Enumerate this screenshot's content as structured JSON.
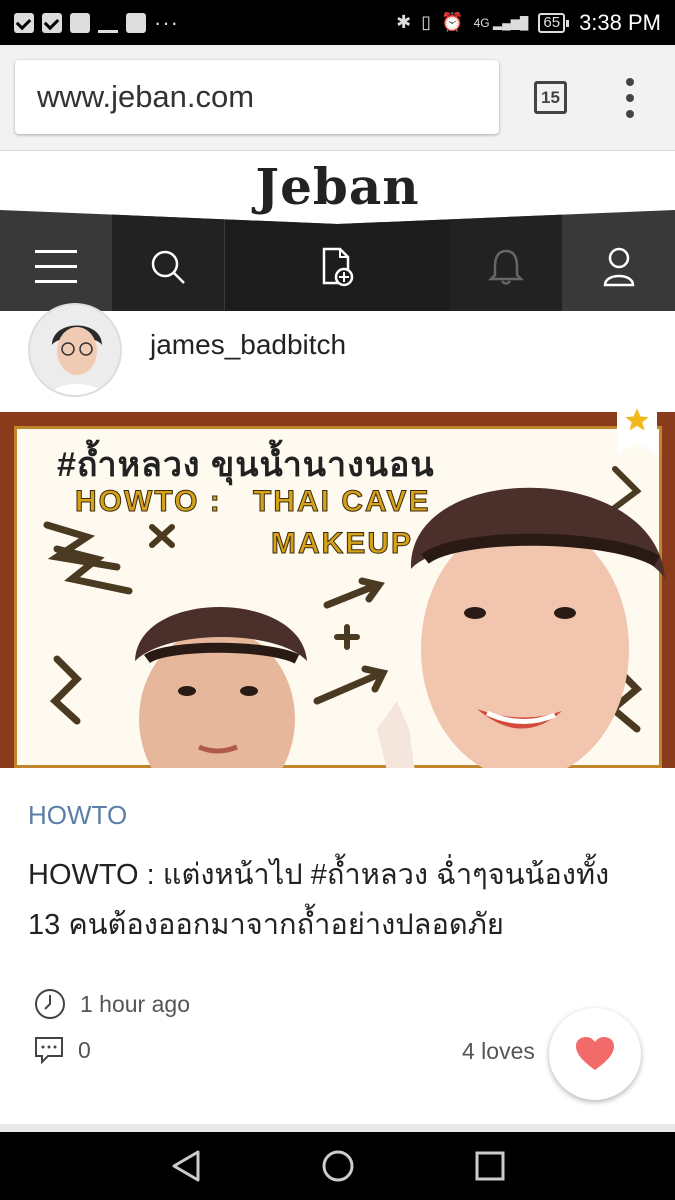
{
  "status_bar": {
    "time": "3:38 PM",
    "battery": "65",
    "network": "4G"
  },
  "browser": {
    "url": "www.jeban.com",
    "tab_count": "15"
  },
  "site": {
    "logo": "Jeban"
  },
  "nav": {
    "items": [
      {
        "icon": "hamburger-menu-icon"
      },
      {
        "icon": "search-icon"
      },
      {
        "icon": "new-post-icon"
      },
      {
        "icon": "bell-icon"
      },
      {
        "icon": "user-icon"
      }
    ]
  },
  "author": {
    "name": "james_badbitch"
  },
  "hero": {
    "thai_title": "#ถ้ำหลวง ขุนน้ำนางนอน",
    "howto": "HOWTO :",
    "thai_cave": "THAI CAVE",
    "makeup": "MAKEUP"
  },
  "article": {
    "category": "HOWTO",
    "title": "HOWTO : แต่งหน้าไป #ถ้ำหลวง ฉ่ำๆจนน้องทั้ง 13 คนต้องออกมาจากถ้ำอย่างปลอดภัย",
    "time_ago": "1 hour ago",
    "comments": "0",
    "loves": "4 loves"
  },
  "colors": {
    "category": "#5c7fa8",
    "heart": "#f26a6a",
    "nav_bg": "#393939"
  }
}
